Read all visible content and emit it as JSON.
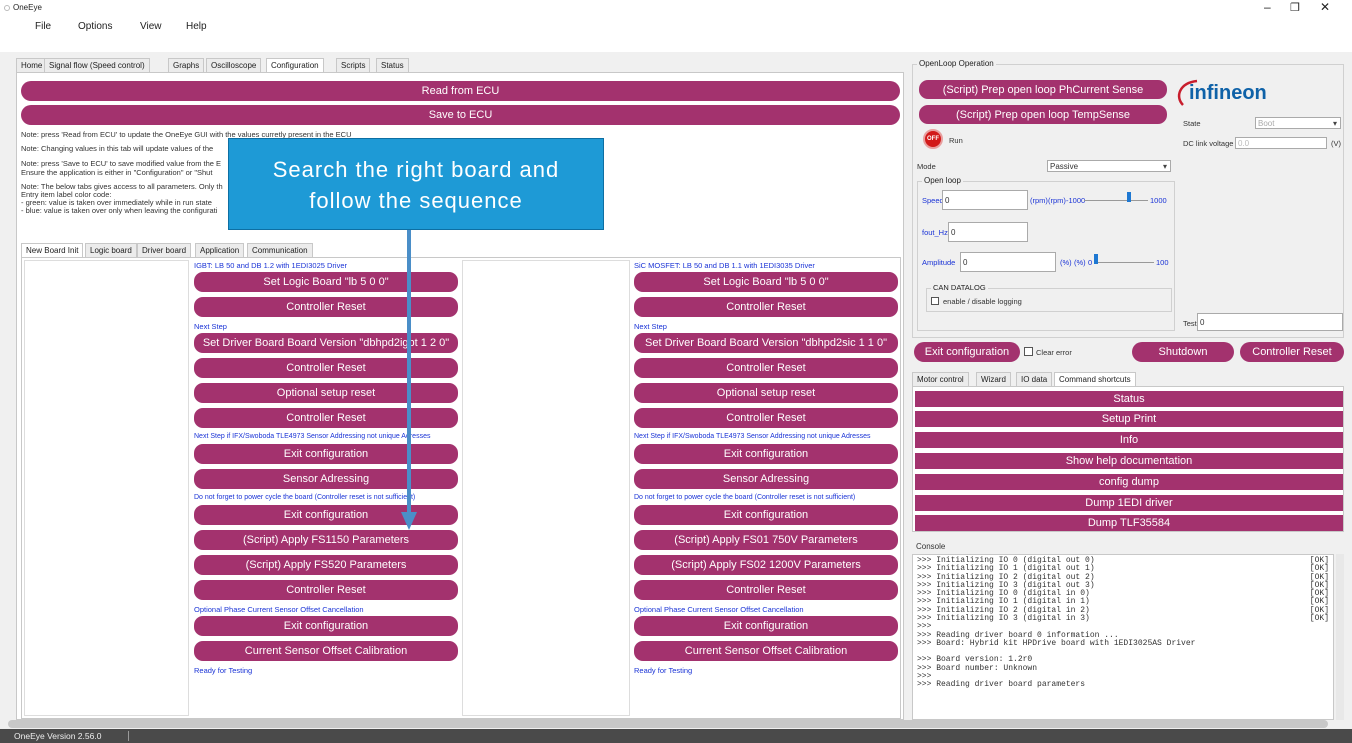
{
  "window": {
    "title": "OneEye"
  },
  "menu": [
    "File",
    "Options",
    "View",
    "Help"
  ],
  "main_tabs": [
    "Home",
    "Signal flow (Speed control)",
    "Graphs",
    "Oscilloscope",
    "Configuration",
    "Scripts",
    "Status"
  ],
  "config": {
    "read_btn": "Read from ECU",
    "save_btn": "Save to ECU",
    "notes": [
      "Note: press 'Read from ECU' to update the OneEye GUI with the values curretly present in the ECU",
      "Note: Changing values in this tab will update values of the",
      "Note: press 'Save to ECU' to save modified value from the E",
      "Ensure the application is either in \"Configuration\" or \"Shut",
      "Note: The below tabs gives access to all parameters. Only th",
      "Entry item label color code:",
      "- green: value is taken over immediately while in run state",
      "- blue: value is taken over only when leaving the configurati"
    ]
  },
  "callout": {
    "line1": "Search the right board and",
    "line2": "follow the sequence"
  },
  "sub_tabs": [
    "New Board Init",
    "Logic board",
    "Driver board",
    "Application",
    "Communication"
  ],
  "left_col": {
    "header": "IGBT: LB 50 and DB 1.2 with 1EDI3025 Driver",
    "b1": "Set Logic Board \"lb 5 0 0\"",
    "b2": "Controller Reset",
    "l1": "Next Step",
    "b3": "Set Driver Board Board Version \"dbhpd2igbt 1 2 0\"",
    "b4": "Controller Reset",
    "b5": "Optional setup reset",
    "b6": "Controller Reset",
    "l2": "Next Step if IFX/Swoboda TLE4973 Sensor Addressing not unique Adresses",
    "b7": "Exit configuration",
    "b8": "Sensor Adressing",
    "l3": "Do not forget to power cycle the board (Controller reset is not sufficient)",
    "b9": "Exit configuration",
    "b10": "(Script) Apply FS1150 Parameters",
    "b11": "(Script) Apply FS520 Parameters",
    "b12": "Controller Reset",
    "l4": "Optional Phase Current Sensor Offset Cancellation",
    "b13": "Exit configuration",
    "b14": "Current Sensor Offset Calibration",
    "l5": "Ready for Testing"
  },
  "right_col": {
    "header": "SiC MOSFET: LB 50 and DB 1.1 with 1EDI3035 Driver",
    "b1": "Set Logic Board \"lb 5 0 0\"",
    "b2": "Controller Reset",
    "l1": "Next Step",
    "b3": "Set Driver Board Board Version \"dbhpd2sic 1 1 0\"",
    "b4": "Controller Reset",
    "b5": "Optional setup reset",
    "b6": "Controller Reset",
    "l2": "Next Step if IFX/Swoboda TLE4973 Sensor Addressing not unique Adresses",
    "b7": "Exit configuration",
    "b8": "Sensor Adressing",
    "l3": "Do not forget to power cycle the board (Controller reset is not sufficient)",
    "b9": "Exit configuration",
    "b10": "(Script) Apply FS01 750V Parameters",
    "b11": "(Script) Apply FS02 1200V Parameters",
    "b12": "Controller Reset",
    "l4": "Optional Phase Current Sensor Offset Cancellation",
    "b13": "Exit configuration",
    "b14": "Current Sensor Offset Calibration",
    "l5": "Ready for Testing"
  },
  "openloop": {
    "group": "OpenLoop Operation",
    "script1": "(Script) Prep open loop PhCurrent Sense",
    "script2": "(Script) Prep open loop TempSense",
    "logo": "infineon",
    "state_label": "State",
    "state_value": "Boot",
    "dclink_label": "DC link voltage",
    "dclink_value": "0.0",
    "dclink_unit": "(V)",
    "run_badge": "OFF",
    "run_label": "Run",
    "mode_label": "Mode",
    "mode_value": "Passive",
    "openloop_group": "Open loop",
    "speed_label": "Speed",
    "speed_value": "0",
    "speed_unit": "(rpm)",
    "speed_range_unit": "(rpm)",
    "speed_min": "-1000",
    "speed_max": "1000",
    "speed_fraction": 0.72,
    "fout_label": "fout_Hz",
    "fout_value": "0",
    "amp_label": "Amplitude",
    "amp_value": "0",
    "amp_unit": "(%)",
    "amp_range_unit": "(%)",
    "amp_min": "0",
    "amp_max": "100",
    "amp_fraction": 0.0,
    "can_group": "CAN DATALOG",
    "can_check": "enable / disable logging",
    "test_label": "Test",
    "test_value": "0",
    "exit_btn": "Exit configuration",
    "clear_error": "Clear error",
    "shutdown_btn": "Shutdown",
    "reset_btn": "Controller Reset"
  },
  "right_tabs": [
    "Motor control",
    "Wizard",
    "IO data",
    "Command shortcuts"
  ],
  "shortcuts": [
    "Status",
    "Setup Print",
    "Info",
    "Show help documentation",
    "config dump",
    "Dump 1EDI driver",
    "Dump TLF35584"
  ],
  "console": {
    "label": "Console",
    "lines": [
      [
        ">>> Initializing IO 0 (digital out 0)",
        "[OK]"
      ],
      [
        ">>> Initializing IO 1 (digital out 1)",
        "[OK]"
      ],
      [
        ">>> Initializing IO 2 (digital out 2)",
        "[OK]"
      ],
      [
        ">>> Initializing IO 3 (digital out 3)",
        "[OK]"
      ],
      [
        ">>> Initializing IO 0 (digital in 0)",
        "[OK]"
      ],
      [
        ">>> Initializing IO 1 (digital in 1)",
        "[OK]"
      ],
      [
        ">>> Initializing IO 2 (digital in 2)",
        "[OK]"
      ],
      [
        ">>> Initializing IO 3 (digital in 3)",
        "[OK]"
      ],
      [
        ">>>",
        ""
      ],
      [
        ">>> Reading driver board 0 information ...",
        ""
      ],
      [
        ">>> Board: Hybrid kit HPDrive board with 1EDI3025AS Driver",
        ""
      ],
      [
        "",
        ""
      ],
      [
        ">>> Board version: 1.2r0",
        ""
      ],
      [
        ">>> Board number: Unknown",
        ""
      ],
      [
        ">>>",
        ""
      ],
      [
        ">>> Reading driver board parameters",
        ""
      ]
    ]
  },
  "status_bar": "OneEye Version 2.56.0",
  "colors": {
    "accent": "#a3326e",
    "callout": "#1e9ad6",
    "link": "#1a33d6"
  }
}
